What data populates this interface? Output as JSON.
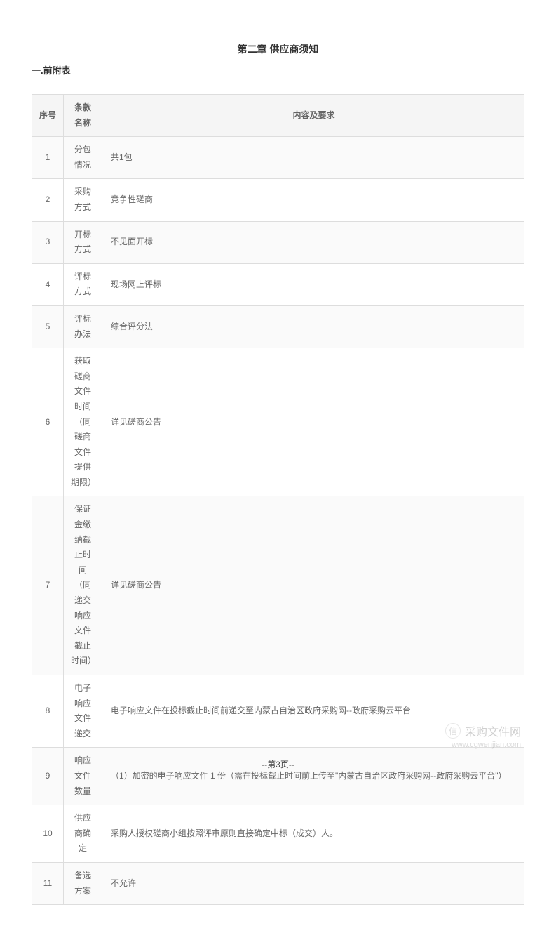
{
  "chapter_title": "第二章 供应商须知",
  "section_title": "一.前附表",
  "table_headers": {
    "seq": "序号",
    "name": "条款名称",
    "content": "内容及要求"
  },
  "rows": [
    {
      "seq": "1",
      "name": "分包情况",
      "content": "共1包"
    },
    {
      "seq": "2",
      "name": "采购方式",
      "content": "竞争性磋商"
    },
    {
      "seq": "3",
      "name": "开标方式",
      "content": "不见面开标"
    },
    {
      "seq": "4",
      "name": "评标方式",
      "content": "现场网上评标"
    },
    {
      "seq": "5",
      "name": "评标办法",
      "content": "综合评分法"
    },
    {
      "seq": "6",
      "name": "获取磋商文件时间（同磋商文件提供期限）",
      "content": "详见磋商公告"
    },
    {
      "seq": "7",
      "name": "保证金缴纳截止时间（同递交响应文件截止时间）",
      "content": "详见磋商公告"
    },
    {
      "seq": "8",
      "name": "电子响应文件递交",
      "content": "电子响应文件在投标截止时间前递交至内蒙古自治区政府采购网--政府采购云平台"
    },
    {
      "seq": "9",
      "name": "响应文件数量",
      "content": "（1）加密的电子响应文件 1 份（需在投标截止时间前上传至\"内蒙古自治区政府采购网--政府采购云平台\"）"
    },
    {
      "seq": "10",
      "name": "供应商确定",
      "content": "采购人授权磋商小组按照评审原则直接确定中标（成交）人。"
    },
    {
      "seq": "11",
      "name": "备选方案",
      "content": "不允许"
    }
  ],
  "watermark": {
    "icon_text": "信",
    "text": "采购文件网",
    "url": "www.cgwenjian.com"
  },
  "page_number": "--第3页--"
}
